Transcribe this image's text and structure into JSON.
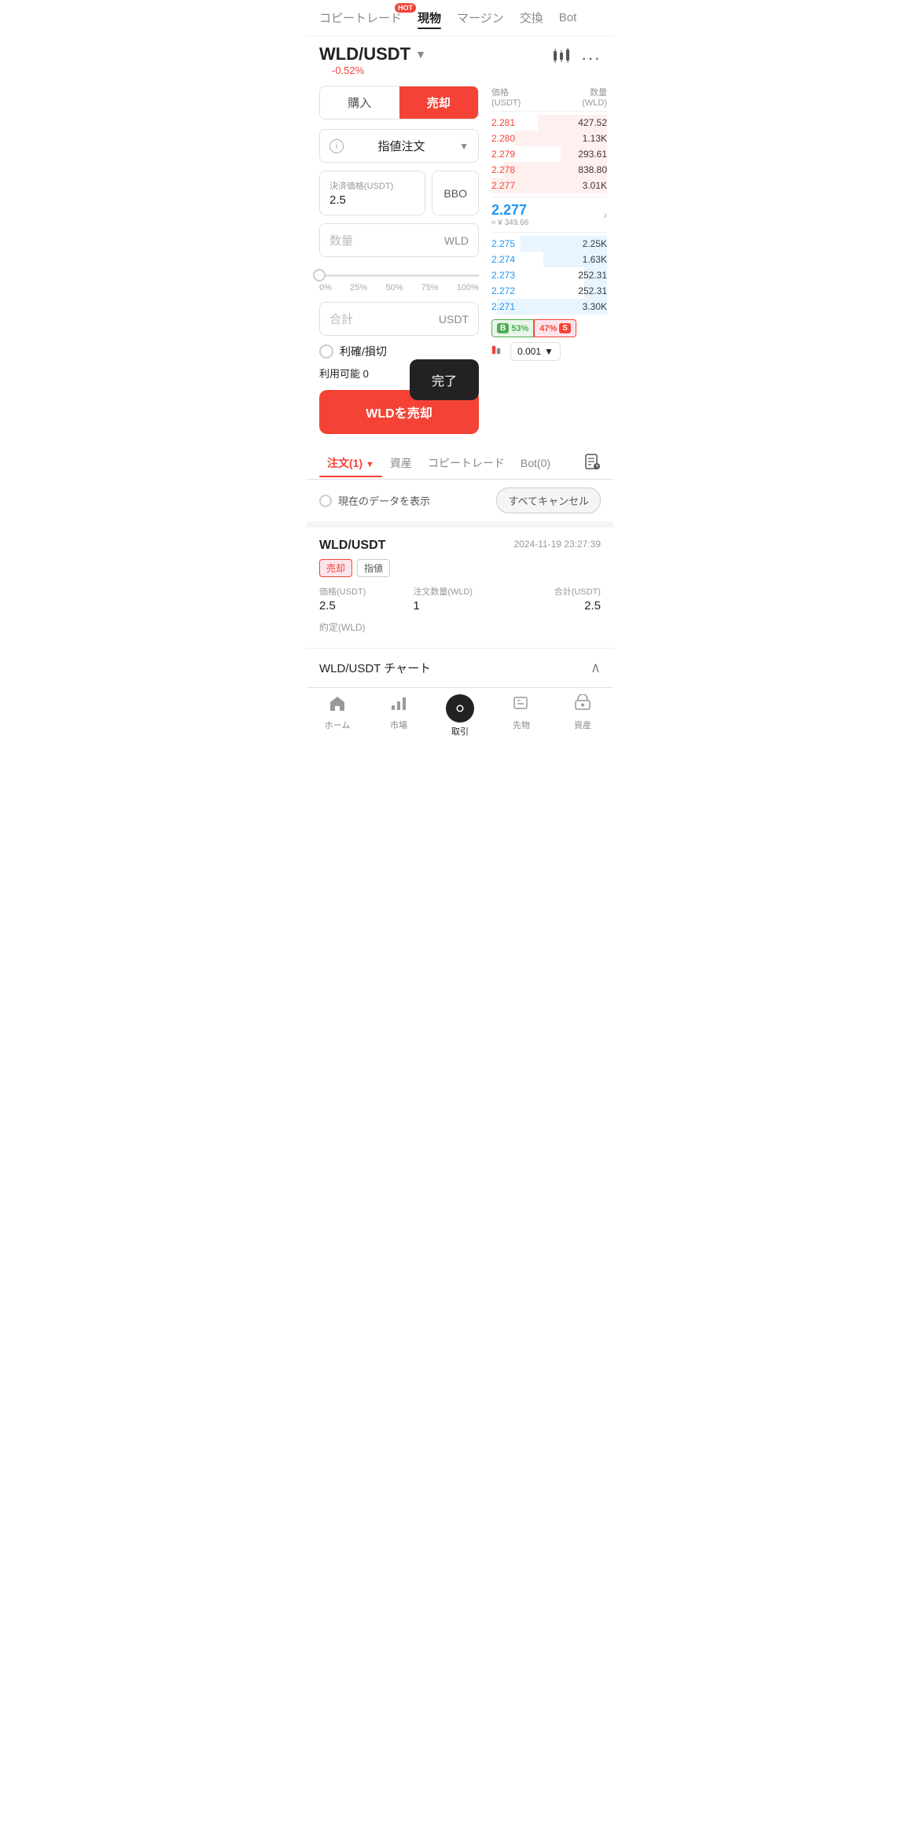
{
  "nav": {
    "items": [
      {
        "label": "コピートレード",
        "id": "copy-trade",
        "hot": true,
        "active": false
      },
      {
        "label": "現物",
        "id": "spot",
        "active": true
      },
      {
        "label": "マージン",
        "id": "margin",
        "active": false
      },
      {
        "label": "交換",
        "id": "exchange",
        "active": false
      },
      {
        "label": "Bot",
        "id": "bot",
        "active": false
      }
    ]
  },
  "pair": {
    "name": "WLD/USDT",
    "change": "-0.52%"
  },
  "order_form": {
    "buy_label": "購入",
    "sell_label": "売却",
    "order_type": "指値注文",
    "price_label": "決済価格(USDT)",
    "price_value": "2.5",
    "bbo_label": "BBO",
    "qty_placeholder": "数量",
    "qty_unit": "WLD",
    "slider_labels": [
      "0%",
      "25%",
      "50%",
      "75%",
      "100%"
    ],
    "total_placeholder": "合計",
    "total_unit": "USDT",
    "tpsl_label": "利確/損切",
    "available_label": "利用可能",
    "available_value": "0",
    "sell_btn": "WLDを売却",
    "done_popup": "完了"
  },
  "orderbook": {
    "header": {
      "price_label": "価格",
      "price_unit": "(USDT)",
      "qty_label": "数量",
      "qty_unit": "(WLD)"
    },
    "asks": [
      {
        "price": "2.281",
        "qty": "427.52",
        "bg_pct": 60
      },
      {
        "price": "2.280",
        "qty": "1.13K",
        "bg_pct": 80
      },
      {
        "price": "2.279",
        "qty": "293.61",
        "bg_pct": 40
      },
      {
        "price": "2.278",
        "qty": "838.80",
        "bg_pct": 90
      },
      {
        "price": "2.277",
        "qty": "3.01K",
        "bg_pct": 100
      }
    ],
    "current_price": "2.277",
    "current_price_jpy": "≈ ¥ 349.66",
    "bids": [
      {
        "price": "2.275",
        "qty": "2.25K",
        "bg_pct": 75
      },
      {
        "price": "2.274",
        "qty": "1.63K",
        "bg_pct": 55
      },
      {
        "price": "2.273",
        "qty": "252.31",
        "bg_pct": 20
      },
      {
        "price": "2.272",
        "qty": "252.31",
        "bg_pct": 20
      },
      {
        "price": "2.271",
        "qty": "3.30K",
        "bg_pct": 95
      }
    ],
    "ratio": {
      "buy_pct": "53%",
      "sell_pct": "47%"
    },
    "precision": "0.001"
  },
  "bottom_tabs": {
    "order_tab": "注文(1)",
    "assets_tab": "資産",
    "copy_trade_tab": "コピートレード",
    "bot_tab": "Bot(0)"
  },
  "order_list": {
    "show_current": "現在のデータを表示",
    "cancel_all": "すべてキャンセル"
  },
  "order_card": {
    "pair": "WLD/USDT",
    "time": "2024-11-19 23:27:39",
    "tag_sell": "売却",
    "tag_limit": "指値",
    "price_label": "価格(USDT)",
    "price_value": "2.5",
    "qty_label": "注文数量(WLD)",
    "qty_value": "1",
    "total_label": "合計(USDT)",
    "total_value": "2.5",
    "filled_label": "約定(WLD)"
  },
  "chart_row": {
    "label": "WLD/USDT チャート"
  },
  "bottom_nav": {
    "items": [
      {
        "label": "ホーム",
        "icon": "🏠",
        "id": "home",
        "active": false
      },
      {
        "label": "市場",
        "icon": "📊",
        "id": "market",
        "active": false
      },
      {
        "label": "取引",
        "icon": "●",
        "id": "trade",
        "active": true
      },
      {
        "label": "先物",
        "icon": "🗂",
        "id": "futures",
        "active": false
      },
      {
        "label": "資産",
        "icon": "👛",
        "id": "assets",
        "active": false
      }
    ]
  }
}
